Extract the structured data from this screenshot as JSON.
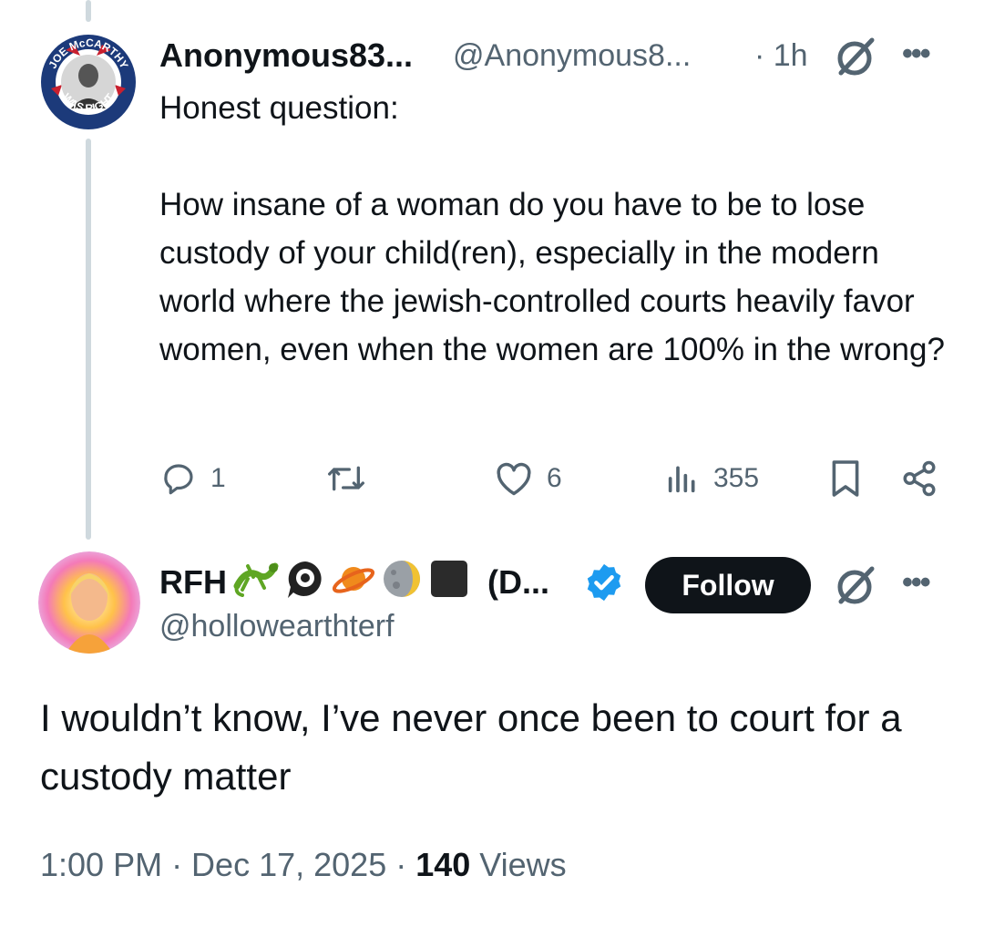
{
  "tweet": {
    "display_name": "Anonymous83...",
    "handle": "@Anonymous8...",
    "time": "· 1h",
    "avatar_text_top": "JOE McCARTHY",
    "avatar_text_bottom": "WAS RIGHT",
    "body_line_1": "Honest question:",
    "body_paragraph": "How insane of a woman do you have to be to lose custody of your child(ren), especially in the modern world where the jewish-controlled courts heavily favor women, even when the women are 100% in the wrong?",
    "reply_count": "1",
    "like_count": "6",
    "view_count": "355"
  },
  "reply": {
    "display_name": "RFH",
    "name_suffix": "(D...",
    "handle": "@hollowearthterf",
    "follow_label": "Follow",
    "body": "I wouldn’t know, I’ve never once been to court for a custody matter",
    "time": "1:00 PM · Dec 17, 2025 · ",
    "views_count": "140",
    "views_label": " Views"
  },
  "icons": {
    "reply": "comment-icon",
    "retweet": "retweet-icon",
    "like": "heart-icon",
    "views": "analytics-icon",
    "bookmark": "bookmark-icon",
    "share": "share-icon",
    "grok": "grok-icon",
    "more": "more-icon",
    "verified": "verified-badge-icon"
  },
  "colors": {
    "text": "#0f1419",
    "secondary": "#536471",
    "verified": "#1d9bf0",
    "thread_line": "#cfd9de"
  }
}
